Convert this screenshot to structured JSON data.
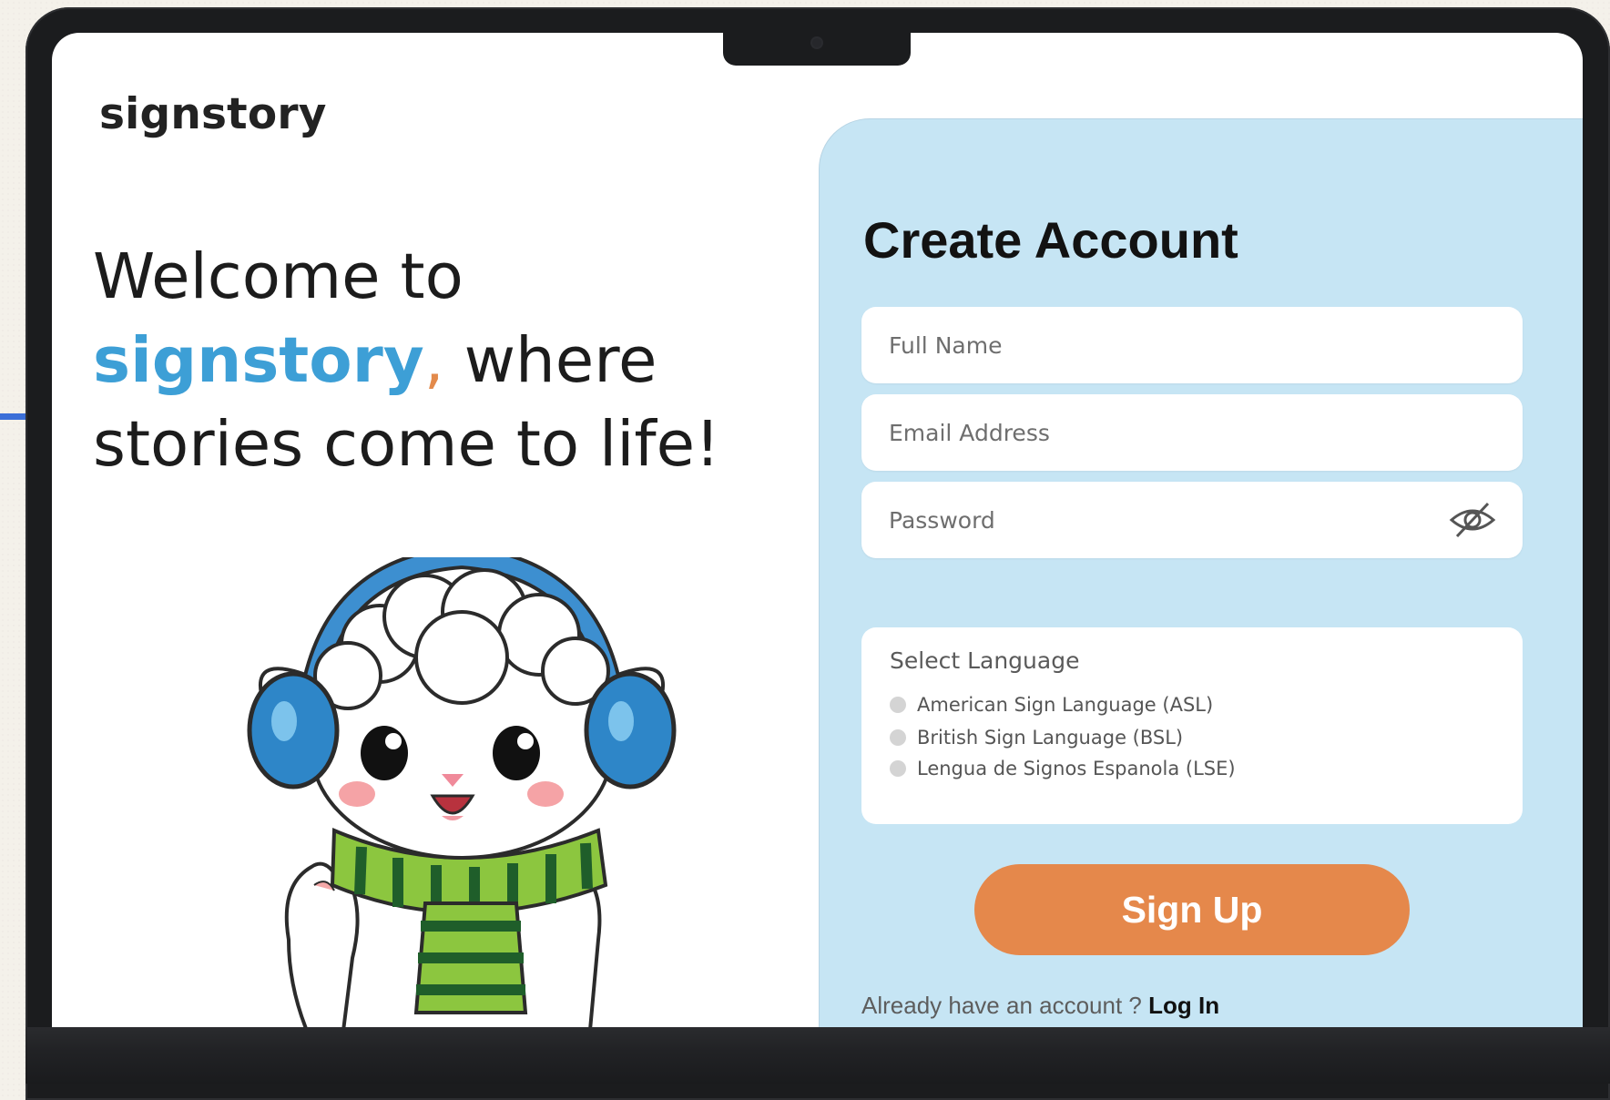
{
  "brand": {
    "name": "signstory"
  },
  "welcome": {
    "line1": "Welcome to",
    "highlight": "signstory",
    "comma": ",",
    "after_highlight": " where",
    "line3": "stories come to life!"
  },
  "form": {
    "title": "Create Account",
    "full_name_placeholder": "Full Name",
    "email_placeholder": "Email Address",
    "password_placeholder": "Password",
    "language": {
      "label": "Select Language",
      "options": [
        "American Sign Language (ASL)",
        "British Sign Language (BSL)",
        "Lengua de Signos Espanola (LSE)"
      ]
    },
    "signup_label": "Sign Up",
    "login_prompt": "Already have an account ?",
    "login_label": "Log In"
  },
  "colors": {
    "brand_blue": "#3d9fd6",
    "accent_orange": "#e5884b",
    "panel_bg": "#c6e5f4"
  },
  "icons": {
    "password_toggle": "eye-slash-icon",
    "mascot": "sheep-mascot-illustration"
  }
}
